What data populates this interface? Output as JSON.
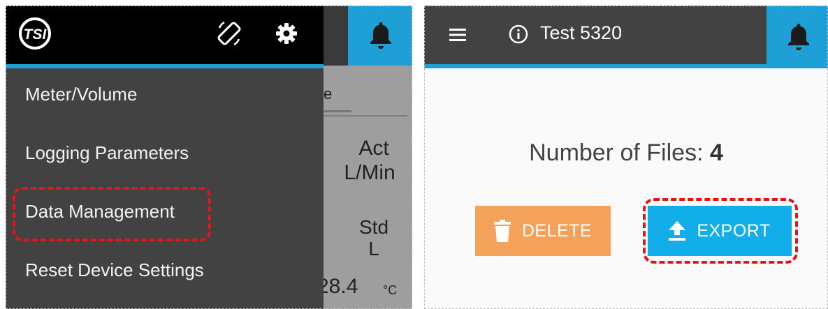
{
  "left_panel": {
    "background_labels": {
      "tab_fragment": "e",
      "act_label": "Act",
      "act_unit": "L/Min",
      "std_label": "Std",
      "std_unit": "L",
      "temp_value": "28.4",
      "temp_unit": "°C"
    },
    "drawer": {
      "logo_text": "TSI",
      "menu_items": [
        {
          "label": "Meter/Volume"
        },
        {
          "label": "Logging Parameters"
        },
        {
          "label": "Data Management",
          "highlighted": true
        },
        {
          "label": "Reset Device Settings"
        }
      ]
    }
  },
  "right_panel": {
    "title": "Test 5320",
    "files_label": "Number of Files:",
    "files_count": "4",
    "buttons": {
      "delete": "DELETE",
      "export": "EXPORT"
    }
  },
  "colors": {
    "accent_blue": "#1ea0d6",
    "delete_orange": "#f4a259",
    "export_blue": "#12aee9",
    "highlight_red": "#e0161b",
    "drawer_bg": "#424242"
  },
  "icons": [
    "tsi-logo-icon",
    "rotate-icon",
    "gear-icon",
    "bell-icon",
    "menu-icon",
    "info-icon",
    "trash-icon",
    "upload-icon"
  ]
}
